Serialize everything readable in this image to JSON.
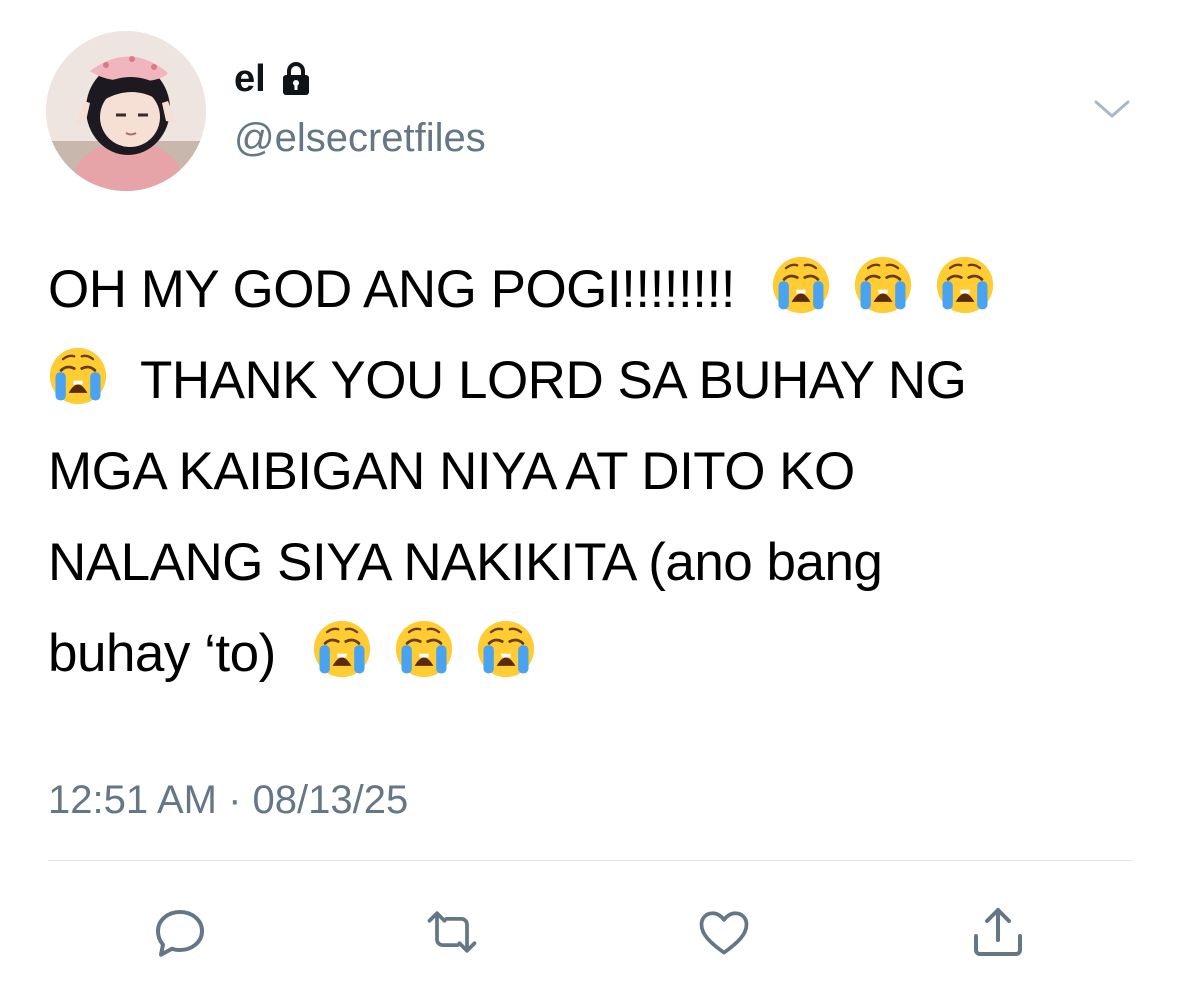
{
  "author": {
    "display_name": "el",
    "handle": "@elsecretfiles",
    "avatar_icon": "avatar",
    "protected_icon": "lock-icon"
  },
  "tweet": {
    "lines": [
      {
        "text": "OH MY GOD ANG POGI!!!!!!!!",
        "trailing_emoji": 3
      },
      {
        "lead_emoji": 1,
        "text": "THANK YOU LORD SA BUHAY NG"
      },
      {
        "text": "MGA KAIBIGAN NIYA AT DITO KO"
      },
      {
        "text": "NALANG SIYA NAKIKITA (ano bang"
      },
      {
        "text": "buhay ‘to)",
        "trailing_emoji": 3
      }
    ],
    "emoji_name": "loudly-crying-face",
    "timestamp": "12:51 AM · 08/13/25"
  },
  "actions": [
    {
      "name": "reply",
      "icon": "reply-icon"
    },
    {
      "name": "retweet",
      "icon": "retweet-icon"
    },
    {
      "name": "like",
      "icon": "heart-icon"
    },
    {
      "name": "share",
      "icon": "share-icon"
    }
  ],
  "colors": {
    "text": "#000000",
    "secondary": "#657786",
    "icon": "#657786",
    "divider": "#dfe3e7"
  }
}
